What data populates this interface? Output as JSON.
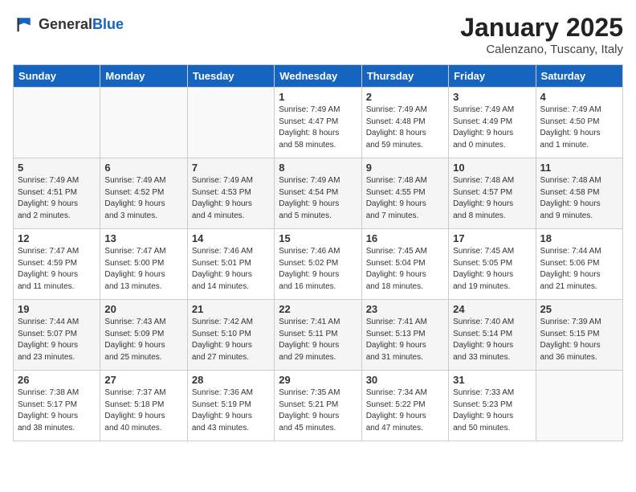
{
  "header": {
    "logo_general": "General",
    "logo_blue": "Blue",
    "month": "January 2025",
    "location": "Calenzano, Tuscany, Italy"
  },
  "weekdays": [
    "Sunday",
    "Monday",
    "Tuesday",
    "Wednesday",
    "Thursday",
    "Friday",
    "Saturday"
  ],
  "weeks": [
    [
      {
        "day": "",
        "info": ""
      },
      {
        "day": "",
        "info": ""
      },
      {
        "day": "",
        "info": ""
      },
      {
        "day": "1",
        "info": "Sunrise: 7:49 AM\nSunset: 4:47 PM\nDaylight: 8 hours\nand 58 minutes."
      },
      {
        "day": "2",
        "info": "Sunrise: 7:49 AM\nSunset: 4:48 PM\nDaylight: 8 hours\nand 59 minutes."
      },
      {
        "day": "3",
        "info": "Sunrise: 7:49 AM\nSunset: 4:49 PM\nDaylight: 9 hours\nand 0 minutes."
      },
      {
        "day": "4",
        "info": "Sunrise: 7:49 AM\nSunset: 4:50 PM\nDaylight: 9 hours\nand 1 minute."
      }
    ],
    [
      {
        "day": "5",
        "info": "Sunrise: 7:49 AM\nSunset: 4:51 PM\nDaylight: 9 hours\nand 2 minutes."
      },
      {
        "day": "6",
        "info": "Sunrise: 7:49 AM\nSunset: 4:52 PM\nDaylight: 9 hours\nand 3 minutes."
      },
      {
        "day": "7",
        "info": "Sunrise: 7:49 AM\nSunset: 4:53 PM\nDaylight: 9 hours\nand 4 minutes."
      },
      {
        "day": "8",
        "info": "Sunrise: 7:49 AM\nSunset: 4:54 PM\nDaylight: 9 hours\nand 5 minutes."
      },
      {
        "day": "9",
        "info": "Sunrise: 7:48 AM\nSunset: 4:55 PM\nDaylight: 9 hours\nand 7 minutes."
      },
      {
        "day": "10",
        "info": "Sunrise: 7:48 AM\nSunset: 4:57 PM\nDaylight: 9 hours\nand 8 minutes."
      },
      {
        "day": "11",
        "info": "Sunrise: 7:48 AM\nSunset: 4:58 PM\nDaylight: 9 hours\nand 9 minutes."
      }
    ],
    [
      {
        "day": "12",
        "info": "Sunrise: 7:47 AM\nSunset: 4:59 PM\nDaylight: 9 hours\nand 11 minutes."
      },
      {
        "day": "13",
        "info": "Sunrise: 7:47 AM\nSunset: 5:00 PM\nDaylight: 9 hours\nand 13 minutes."
      },
      {
        "day": "14",
        "info": "Sunrise: 7:46 AM\nSunset: 5:01 PM\nDaylight: 9 hours\nand 14 minutes."
      },
      {
        "day": "15",
        "info": "Sunrise: 7:46 AM\nSunset: 5:02 PM\nDaylight: 9 hours\nand 16 minutes."
      },
      {
        "day": "16",
        "info": "Sunrise: 7:45 AM\nSunset: 5:04 PM\nDaylight: 9 hours\nand 18 minutes."
      },
      {
        "day": "17",
        "info": "Sunrise: 7:45 AM\nSunset: 5:05 PM\nDaylight: 9 hours\nand 19 minutes."
      },
      {
        "day": "18",
        "info": "Sunrise: 7:44 AM\nSunset: 5:06 PM\nDaylight: 9 hours\nand 21 minutes."
      }
    ],
    [
      {
        "day": "19",
        "info": "Sunrise: 7:44 AM\nSunset: 5:07 PM\nDaylight: 9 hours\nand 23 minutes."
      },
      {
        "day": "20",
        "info": "Sunrise: 7:43 AM\nSunset: 5:09 PM\nDaylight: 9 hours\nand 25 minutes."
      },
      {
        "day": "21",
        "info": "Sunrise: 7:42 AM\nSunset: 5:10 PM\nDaylight: 9 hours\nand 27 minutes."
      },
      {
        "day": "22",
        "info": "Sunrise: 7:41 AM\nSunset: 5:11 PM\nDaylight: 9 hours\nand 29 minutes."
      },
      {
        "day": "23",
        "info": "Sunrise: 7:41 AM\nSunset: 5:13 PM\nDaylight: 9 hours\nand 31 minutes."
      },
      {
        "day": "24",
        "info": "Sunrise: 7:40 AM\nSunset: 5:14 PM\nDaylight: 9 hours\nand 33 minutes."
      },
      {
        "day": "25",
        "info": "Sunrise: 7:39 AM\nSunset: 5:15 PM\nDaylight: 9 hours\nand 36 minutes."
      }
    ],
    [
      {
        "day": "26",
        "info": "Sunrise: 7:38 AM\nSunset: 5:17 PM\nDaylight: 9 hours\nand 38 minutes."
      },
      {
        "day": "27",
        "info": "Sunrise: 7:37 AM\nSunset: 5:18 PM\nDaylight: 9 hours\nand 40 minutes."
      },
      {
        "day": "28",
        "info": "Sunrise: 7:36 AM\nSunset: 5:19 PM\nDaylight: 9 hours\nand 43 minutes."
      },
      {
        "day": "29",
        "info": "Sunrise: 7:35 AM\nSunset: 5:21 PM\nDaylight: 9 hours\nand 45 minutes."
      },
      {
        "day": "30",
        "info": "Sunrise: 7:34 AM\nSunset: 5:22 PM\nDaylight: 9 hours\nand 47 minutes."
      },
      {
        "day": "31",
        "info": "Sunrise: 7:33 AM\nSunset: 5:23 PM\nDaylight: 9 hours\nand 50 minutes."
      },
      {
        "day": "",
        "info": ""
      }
    ]
  ]
}
